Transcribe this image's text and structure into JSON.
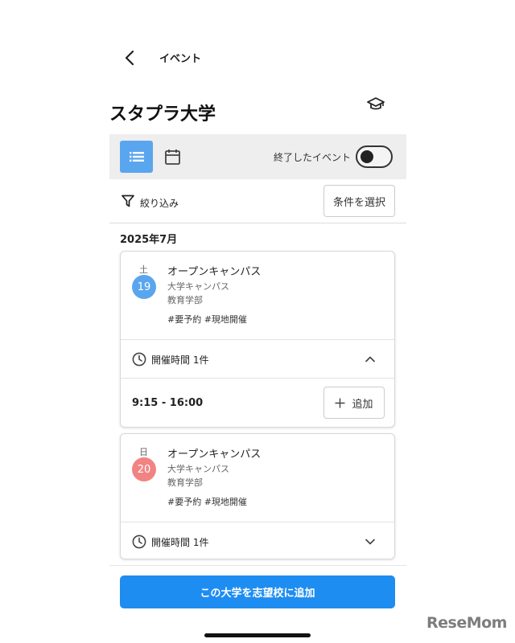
{
  "header": {
    "title": "イベント"
  },
  "university": {
    "name": "スタプラ大学"
  },
  "toolbar": {
    "ended_events_label": "終了したイベント",
    "ended_events_on": false
  },
  "filter": {
    "label": "絞り込み",
    "condition_button": "条件を選択"
  },
  "month": "2025年7月",
  "events": [
    {
      "weekday": "土",
      "date": "19",
      "date_color": "#5aa6ee",
      "title": "オープンキャンパス",
      "place": "大学キャンパス",
      "department": "教育学部",
      "tags": "#要予約 #現地開催",
      "times_label": "開催時間 1件",
      "expanded": true,
      "slot_time": "9:15 - 16:00",
      "add_label": "追加"
    },
    {
      "weekday": "日",
      "date": "20",
      "date_color": "#f28383",
      "title": "オープンキャンパス",
      "place": "大学キャンパス",
      "department": "教育学部",
      "tags": "#要予約 #現地開催",
      "times_label": "開催時間 1件",
      "expanded": false
    }
  ],
  "cta_label": "この大学を志望校に追加",
  "watermark": "ReseMom",
  "colors": {
    "primary": "#1e8df2",
    "list_active": "#5aa6ee",
    "saturday": "#5aa6ee",
    "sunday": "#f28383"
  }
}
